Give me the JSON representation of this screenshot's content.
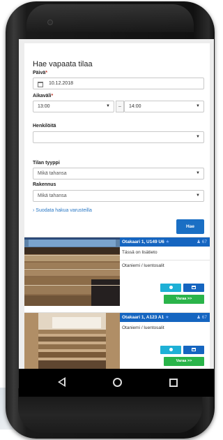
{
  "form": {
    "title": "Hae vapaata tilaa",
    "date_label": "Päivä",
    "required_mark": "*",
    "date_value": "10.12.2018",
    "time_label": "Aikaväli",
    "time_start": "13:00",
    "time_sep": "–",
    "time_end": "14:00",
    "persons_label": "Henkilöitä",
    "persons_value": "",
    "room_type_label": "Tilan tyyppi",
    "room_type_value": "Mikä tahansa",
    "building_label": "Rakennus",
    "building_value": "Mikä tahansa",
    "filter_link": "› Suodata hakua varusteilla",
    "search_button": "Hae"
  },
  "results": [
    {
      "title": "Otakaari 1, U149 U6",
      "capacity": "67",
      "info": "Tässä on lisätieto",
      "location": "Otaniemi / luentosalit",
      "book_label": "Varaa >>"
    },
    {
      "title": "Otakaari 1, A123 A1",
      "capacity": "67",
      "location": "Otaniemi / luentosalit",
      "book_label": "Varaa >>"
    }
  ],
  "colors": {
    "primary": "#1565c0",
    "info": "#1eb0d6",
    "success": "#2ab44a"
  }
}
